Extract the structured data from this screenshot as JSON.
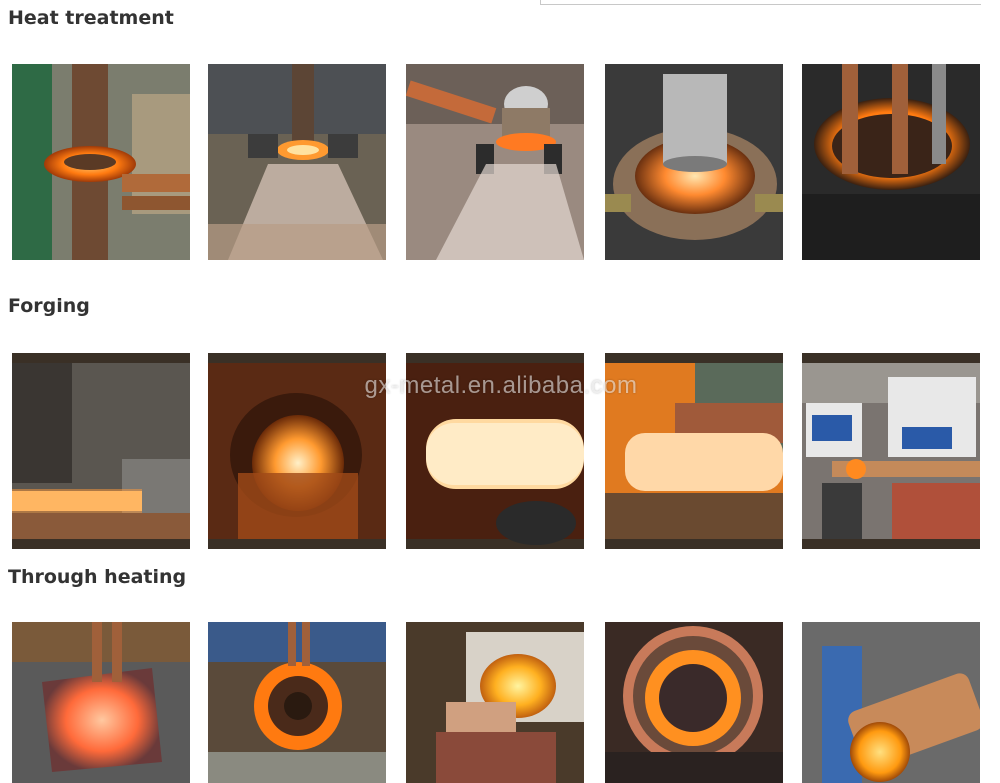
{
  "sections": [
    {
      "title": "Heat treatment",
      "photos": [
        "shaft-ring-coil",
        "quench-spray",
        "ball-quench",
        "cylinder-coil",
        "pipe-coil"
      ]
    },
    {
      "title": "Forging",
      "photos": [
        "bar-furnace",
        "furnace-opening",
        "hot-billet",
        "bar-exit",
        "machines-and-coil"
      ]
    },
    {
      "title": "Through heating",
      "photos": [
        "plate-heating",
        "gear-heating",
        "glowing-cylinder",
        "gear-in-coil",
        "rod-in-coil"
      ]
    }
  ],
  "watermark": "gx-metal.en.alibaba.com"
}
